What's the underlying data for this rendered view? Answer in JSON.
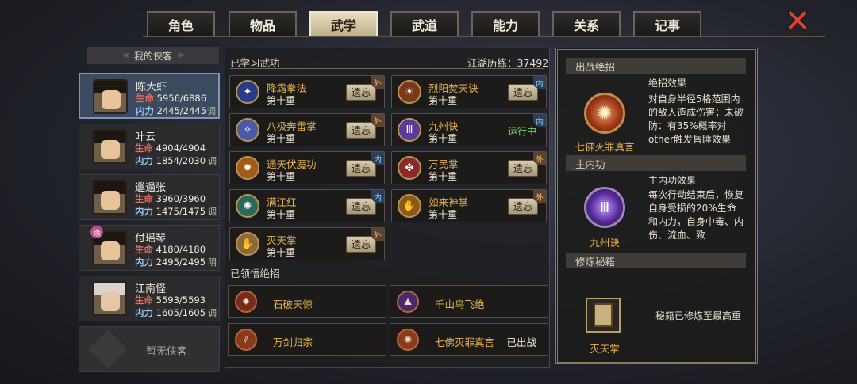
{
  "tabs": [
    {
      "label": "角色",
      "active": false
    },
    {
      "label": "物品",
      "active": false
    },
    {
      "label": "武学",
      "active": true
    },
    {
      "label": "武道",
      "active": false
    },
    {
      "label": "能力",
      "active": false
    },
    {
      "label": "关系",
      "active": false
    },
    {
      "label": "记事",
      "active": false
    }
  ],
  "close_icon": "close-x-icon",
  "roster": {
    "header": "我的侠客",
    "heroes": [
      {
        "name": "陈大虾",
        "hp_label": "生命",
        "hp": "5956/6886",
        "mp_label": "内力",
        "mp": "2445/2445",
        "tag": "调"
      },
      {
        "name": "叶云",
        "hp_label": "生命",
        "hp": "4904/4904",
        "mp_label": "内力",
        "mp": "1854/2030",
        "tag": "调"
      },
      {
        "name": "邋遢张",
        "hp_label": "生命",
        "hp": "3960/3960",
        "mp_label": "内力",
        "mp": "1475/1475",
        "tag": "调"
      },
      {
        "name": "付瑶琴",
        "hp_label": "生命",
        "hp": "4180/4180",
        "mp_label": "内力",
        "mp": "2495/2495",
        "tag": "阴",
        "badge": "缘"
      },
      {
        "name": "江南怪",
        "hp_label": "生命",
        "hp": "5593/5593",
        "mp_label": "内力",
        "mp": "1605/1605",
        "tag": "调"
      }
    ],
    "empty_slot": "暂无侠客"
  },
  "learned": {
    "title": "已学习武功",
    "experience": "江湖历练：37492",
    "forget_label": "遗忘",
    "running_label": "运行中",
    "skills": [
      {
        "name": "降霜拳法",
        "level": "第十重",
        "type": "外",
        "status": "forget"
      },
      {
        "name": "烈阳焚天诀",
        "level": "第十重",
        "type": "内",
        "status": "forget"
      },
      {
        "name": "八极奔雷掌",
        "level": "第十重",
        "type": "外",
        "status": "forget"
      },
      {
        "name": "九州诀",
        "level": "第十重",
        "type": "内",
        "status": "running"
      },
      {
        "name": "通天伏魔功",
        "level": "第十重",
        "type": "内",
        "status": "forget"
      },
      {
        "name": "万民掌",
        "level": "第十重",
        "type": "外",
        "status": "forget"
      },
      {
        "name": "满江红",
        "level": "第十重",
        "type": "内",
        "status": "forget"
      },
      {
        "name": "如来神掌",
        "level": "第十重",
        "type": "外",
        "status": "forget"
      },
      {
        "name": "灭天掌",
        "level": "第十重",
        "type": "外",
        "status": "forget"
      }
    ]
  },
  "ultimates": {
    "title": "已领悟绝招",
    "deployed_label": "已出战",
    "items": [
      {
        "name": "石破天惊",
        "deployed": false
      },
      {
        "name": "千山鸟飞绝",
        "deployed": false
      },
      {
        "name": "万剑归宗",
        "deployed": false
      },
      {
        "name": "七佛灭罪真言",
        "deployed": true
      }
    ]
  },
  "right": {
    "ultimate_head": "出战绝招",
    "ultimate_name": "七佛灭罪真言",
    "ultimate_effect_title": "绝招效果",
    "ultimate_effect": "对自身半径5格范围内的敌人造成伤害；未破防：有35%概率对other触发昏睡效果",
    "inner_head": "主内功",
    "inner_name": "九州诀",
    "inner_effect_title": "主内功效果",
    "inner_effect": "每次行动结束后，恢复自身受损的20%生命和内力，自身中毒、内伤、流血、致",
    "manual_head": "修炼秘籍",
    "manual_name": "灭天掌",
    "manual_status": "秘籍已修炼至最高重"
  },
  "colors": {
    "skill_name": "#e8b44a",
    "active_tab": "#e9ddc0",
    "running": "#6cd870",
    "hp": "#e86a5c",
    "mp": "#9cc4ee"
  }
}
